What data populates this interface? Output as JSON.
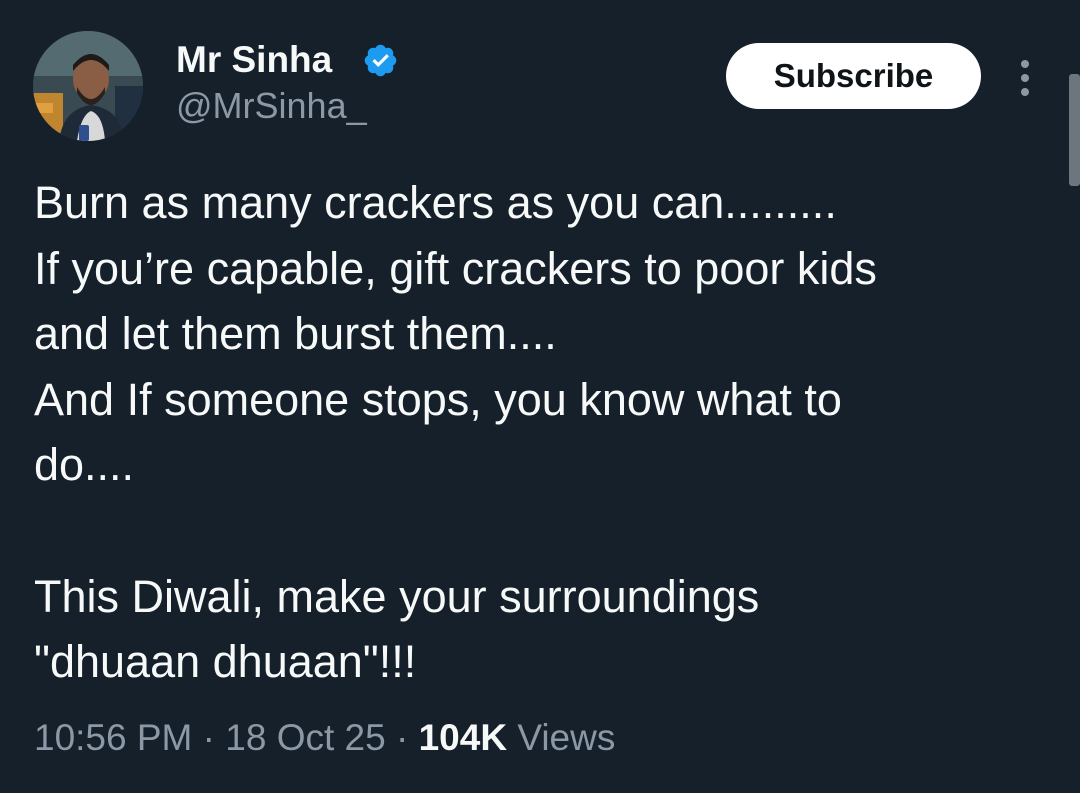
{
  "author": {
    "display_name": "Mr Sinha",
    "handle": "@MrSinha_",
    "verified": true
  },
  "header": {
    "subscribe_label": "Subscribe"
  },
  "tweet": {
    "lines": [
      "Burn as many crackers as you can.........",
      "If you’re capable, gift crackers to poor kids",
      "and let them burst them....",
      "And If someone stops, you know what to",
      "do....",
      "",
      "This Diwali, make your surroundings",
      "\"dhuaan dhuaan\"!!!"
    ]
  },
  "meta": {
    "time": "10:56 PM",
    "separator": "·",
    "date": "18 Oct 25",
    "views_count": "104K",
    "views_label": "Views"
  },
  "colors": {
    "background": "#15202b",
    "text_primary": "#f7f9f9",
    "text_secondary": "#8b98a5",
    "verified_blue": "#1d9bf0",
    "button_bg": "#ffffff",
    "button_text": "#0f1419"
  },
  "icons": {
    "verified": "verified-badge-icon",
    "more": "more-vertical-icon"
  }
}
